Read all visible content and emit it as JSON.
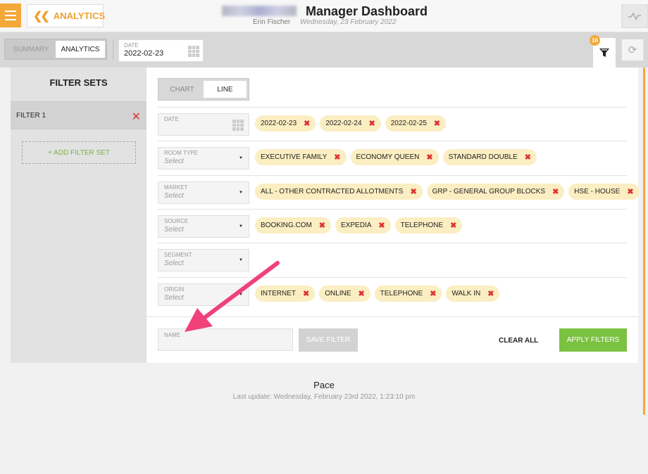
{
  "header": {
    "back_label": "ANALYTICS",
    "title": "Manager Dashboard",
    "user": "Erin Fischer",
    "date": "Wednesday, 23 February 2022"
  },
  "subbar": {
    "views": [
      "SUMMARY",
      "ANALYTICS"
    ],
    "active_view": "ANALYTICS",
    "date_label": "DATE",
    "date_value": "2022-02-23",
    "filter_badge": "16"
  },
  "filter_sets": {
    "title": "FILTER SETS",
    "items": [
      "FILTER 1"
    ],
    "add_label": "+ ADD FILTER SET"
  },
  "chart_type": {
    "options": [
      "CHART",
      "LINE"
    ],
    "active": "LINE"
  },
  "filters": [
    {
      "label": "DATE",
      "value": "",
      "kind": "date",
      "chips": [
        "2022-02-23",
        "2022-02-24",
        "2022-02-25"
      ]
    },
    {
      "label": "ROOM TYPE",
      "value": "Select",
      "kind": "select",
      "chips": [
        "EXECUTIVE FAMILY",
        "ECONOMY QUEEN",
        "STANDARD DOUBLE"
      ]
    },
    {
      "label": "MARKET",
      "value": "Select",
      "kind": "select",
      "chips": [
        "ALL - OTHER CONTRACTED ALLOTMENTS",
        "GRP - GENERAL GROUP BLOCKS",
        "HSE - HOUSE"
      ]
    },
    {
      "label": "SOURCE",
      "value": "Select",
      "kind": "select",
      "chips": [
        "BOOKING.COM",
        "EXPEDIA",
        "TELEPHONE"
      ]
    },
    {
      "label": "SEGMENT",
      "value": "Select",
      "kind": "select",
      "chips": []
    },
    {
      "label": "ORIGIN",
      "value": "Select",
      "kind": "select",
      "chips": [
        "INTERNET",
        "ONLINE",
        "TELEPHONE",
        "WALK IN"
      ]
    }
  ],
  "actions": {
    "name_placeholder": "NAME",
    "save": "SAVE FILTER",
    "clear": "CLEAR ALL",
    "apply": "APPLY FILTERS"
  },
  "pace": {
    "title": "Pace",
    "last_update": "Last update: Wednesday, February 23rd 2022, 1:23:10 pm"
  },
  "colors": {
    "accent": "#f3a83a",
    "chip": "#fbeec2",
    "remove": "#d33333",
    "apply": "#7cc242",
    "annotation_arrow": "#f0417a"
  }
}
